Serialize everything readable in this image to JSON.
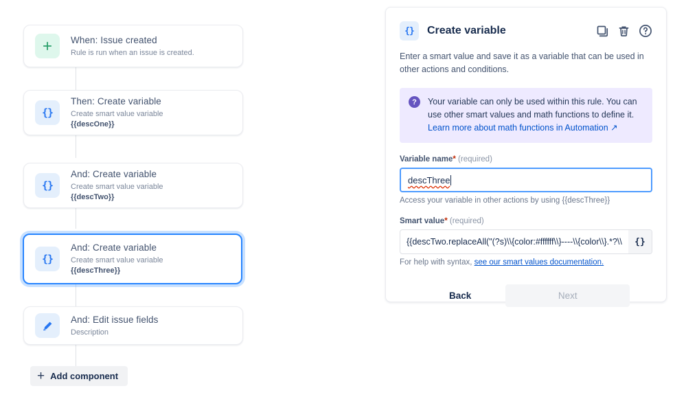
{
  "builder": {
    "cards": [
      {
        "icon": "plus-icon",
        "title": "When: Issue created",
        "sub": "Rule is run when an issue is created.",
        "variable": "",
        "selected": false
      },
      {
        "icon": "braces-icon",
        "title": "Then: Create variable",
        "sub": "Create smart value variable",
        "variable": "{{descOne}}",
        "selected": false
      },
      {
        "icon": "braces-icon",
        "title": "And: Create variable",
        "sub": "Create smart value variable",
        "variable": "{{descTwo}}",
        "selected": false
      },
      {
        "icon": "braces-icon",
        "title": "And: Create variable",
        "sub": "Create smart value variable",
        "variable": "{{descThree}}",
        "selected": true
      },
      {
        "icon": "pencil-icon",
        "title": "And: Edit issue fields",
        "sub": "Description",
        "variable": "",
        "selected": false
      }
    ],
    "add_component_label": "Add component",
    "add_component_glyph": "+"
  },
  "panel": {
    "title": "Create variable",
    "description": "Enter a smart value and save it as a variable that can be used in other actions and conditions.",
    "header_icons": [
      {
        "name": "duplicate-icon"
      },
      {
        "name": "delete-icon"
      },
      {
        "name": "help-icon"
      }
    ],
    "info_banner": {
      "icon_glyph": "?",
      "text": "Your variable can only be used within this rule. You can use other smart values and math functions to define it.",
      "link": "Learn more about math functions in Automation ↗"
    },
    "variable_name": {
      "label": "Variable name",
      "star": "*",
      "required_note": "(required)",
      "value": "descThree",
      "help": "Access your variable in other actions by using {{descThree}}"
    },
    "smart_value": {
      "label": "Smart value",
      "star": "*",
      "required_note": "(required)",
      "value": "{{descTwo.replaceAll(\"(?s)\\\\{color:#ffffff\\\\}----\\\\{color\\\\}.*?\\\\",
      "brace_button": "{}",
      "help_prefix": "For help with syntax, ",
      "help_link": "see our smart values documentation."
    },
    "buttons": {
      "back": "Back",
      "next": "Next"
    }
  },
  "colors": {
    "accent_blue": "#2877f2",
    "selected_border": "#2684ff",
    "green_icon_bg": "#def7ec",
    "blue_icon_bg": "#e4effc",
    "banner_bg": "#eeeaff",
    "banner_icon": "#6554c0",
    "link": "#0052cc"
  }
}
